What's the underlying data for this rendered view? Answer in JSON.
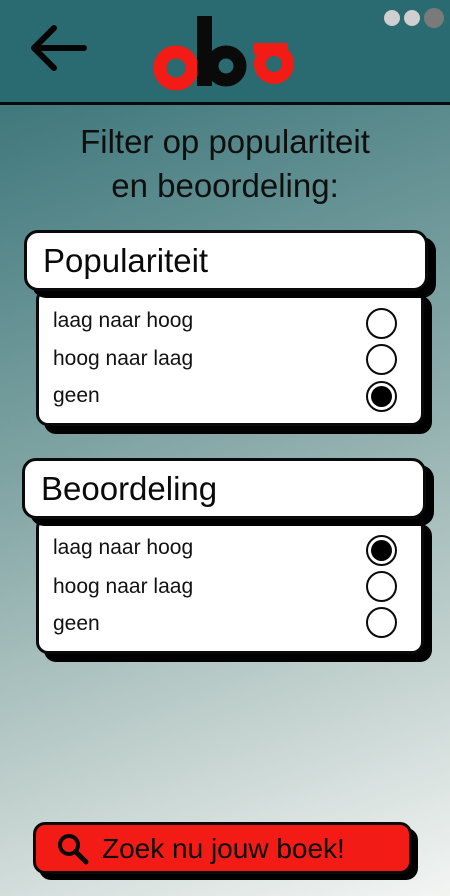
{
  "header": {
    "back_icon": "arrow-left-icon",
    "logo_text": "oba",
    "logo_colors": {
      "primary": "#f31b16",
      "secondary": "#0a0a0a"
    },
    "menu_icon": "more-dots-icon"
  },
  "title": {
    "line1": "Filter op populariteit",
    "line2": "en beoordeling:"
  },
  "popularity": {
    "heading": "Populariteit",
    "options": [
      {
        "label": "laag naar hoog",
        "selected": false
      },
      {
        "label": "hoog naar laag",
        "selected": false
      },
      {
        "label": "geen",
        "selected": true
      }
    ]
  },
  "rating": {
    "heading": "Beoordeling",
    "options": [
      {
        "label": "laag naar hoog",
        "selected": true
      },
      {
        "label": "hoog naar laag",
        "selected": false
      },
      {
        "label": "geen",
        "selected": false
      }
    ]
  },
  "search_button": {
    "label": "Zoek nu jouw boek!",
    "icon": "search-icon",
    "color": "#f31b16"
  }
}
